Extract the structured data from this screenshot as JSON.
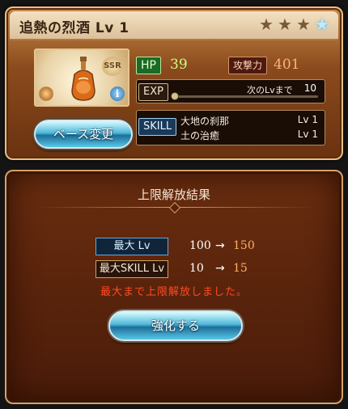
{
  "character": {
    "title": "追熱の烈酒 Lv 1",
    "rarity_badge": "SSR",
    "stars_total": 4,
    "stars_lit": 1,
    "star_glyph": "★"
  },
  "stats": {
    "hp_label": "HP",
    "hp_value": "39",
    "atk_label": "攻撃力",
    "atk_value": "401",
    "exp_label": "EXP",
    "exp_next_label": "次のLvまで",
    "exp_next_value": "10",
    "exp_progress": 0.0
  },
  "skills": {
    "label": "SKILL",
    "items": [
      {
        "name": "大地の刹那",
        "level": "Lv 1"
      },
      {
        "name": "土の治癒",
        "level": "Lv 1"
      }
    ]
  },
  "buttons": {
    "base_change": "ベース変更",
    "enhance": "強化する"
  },
  "result": {
    "title": "上限解放結果",
    "rows": [
      {
        "label": "最大 Lv",
        "old": "100",
        "arrow": "→",
        "new": "150"
      },
      {
        "label": "最大SKILL Lv",
        "old": "10",
        "arrow": "→",
        "new": "15"
      }
    ],
    "message": "最大まで上限解放しました。"
  },
  "icons": {
    "info": "i"
  },
  "colors": {
    "hp_value": "#c6ff8c",
    "atk_value": "#ffb07a",
    "new_value": "#ffb060",
    "message": "#ff4a24"
  }
}
